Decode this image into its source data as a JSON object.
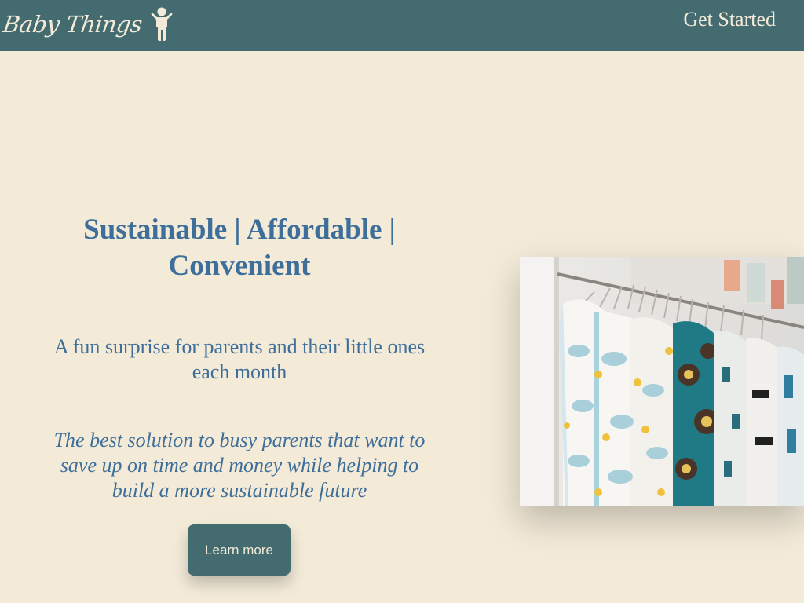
{
  "header": {
    "brand": "Baby Things",
    "brand_icon": "child-icon",
    "nav_link": "Get Started"
  },
  "hero": {
    "headline": "Sustainable | Affordable | Convenient",
    "subheadline": "A fun surprise for parents and their little ones each month",
    "tagline": "The best solution to busy parents that want to save up on time and money while helping to build a more sustainable future",
    "button_label": "Learn more",
    "image": "photo of baby clothes on hangers on a clothing rack"
  },
  "colors": {
    "background": "#f3ead8",
    "header": "#436b70",
    "text_accent": "#3e6e9a",
    "button": "#436b70",
    "light_text": "#f3ead8"
  }
}
